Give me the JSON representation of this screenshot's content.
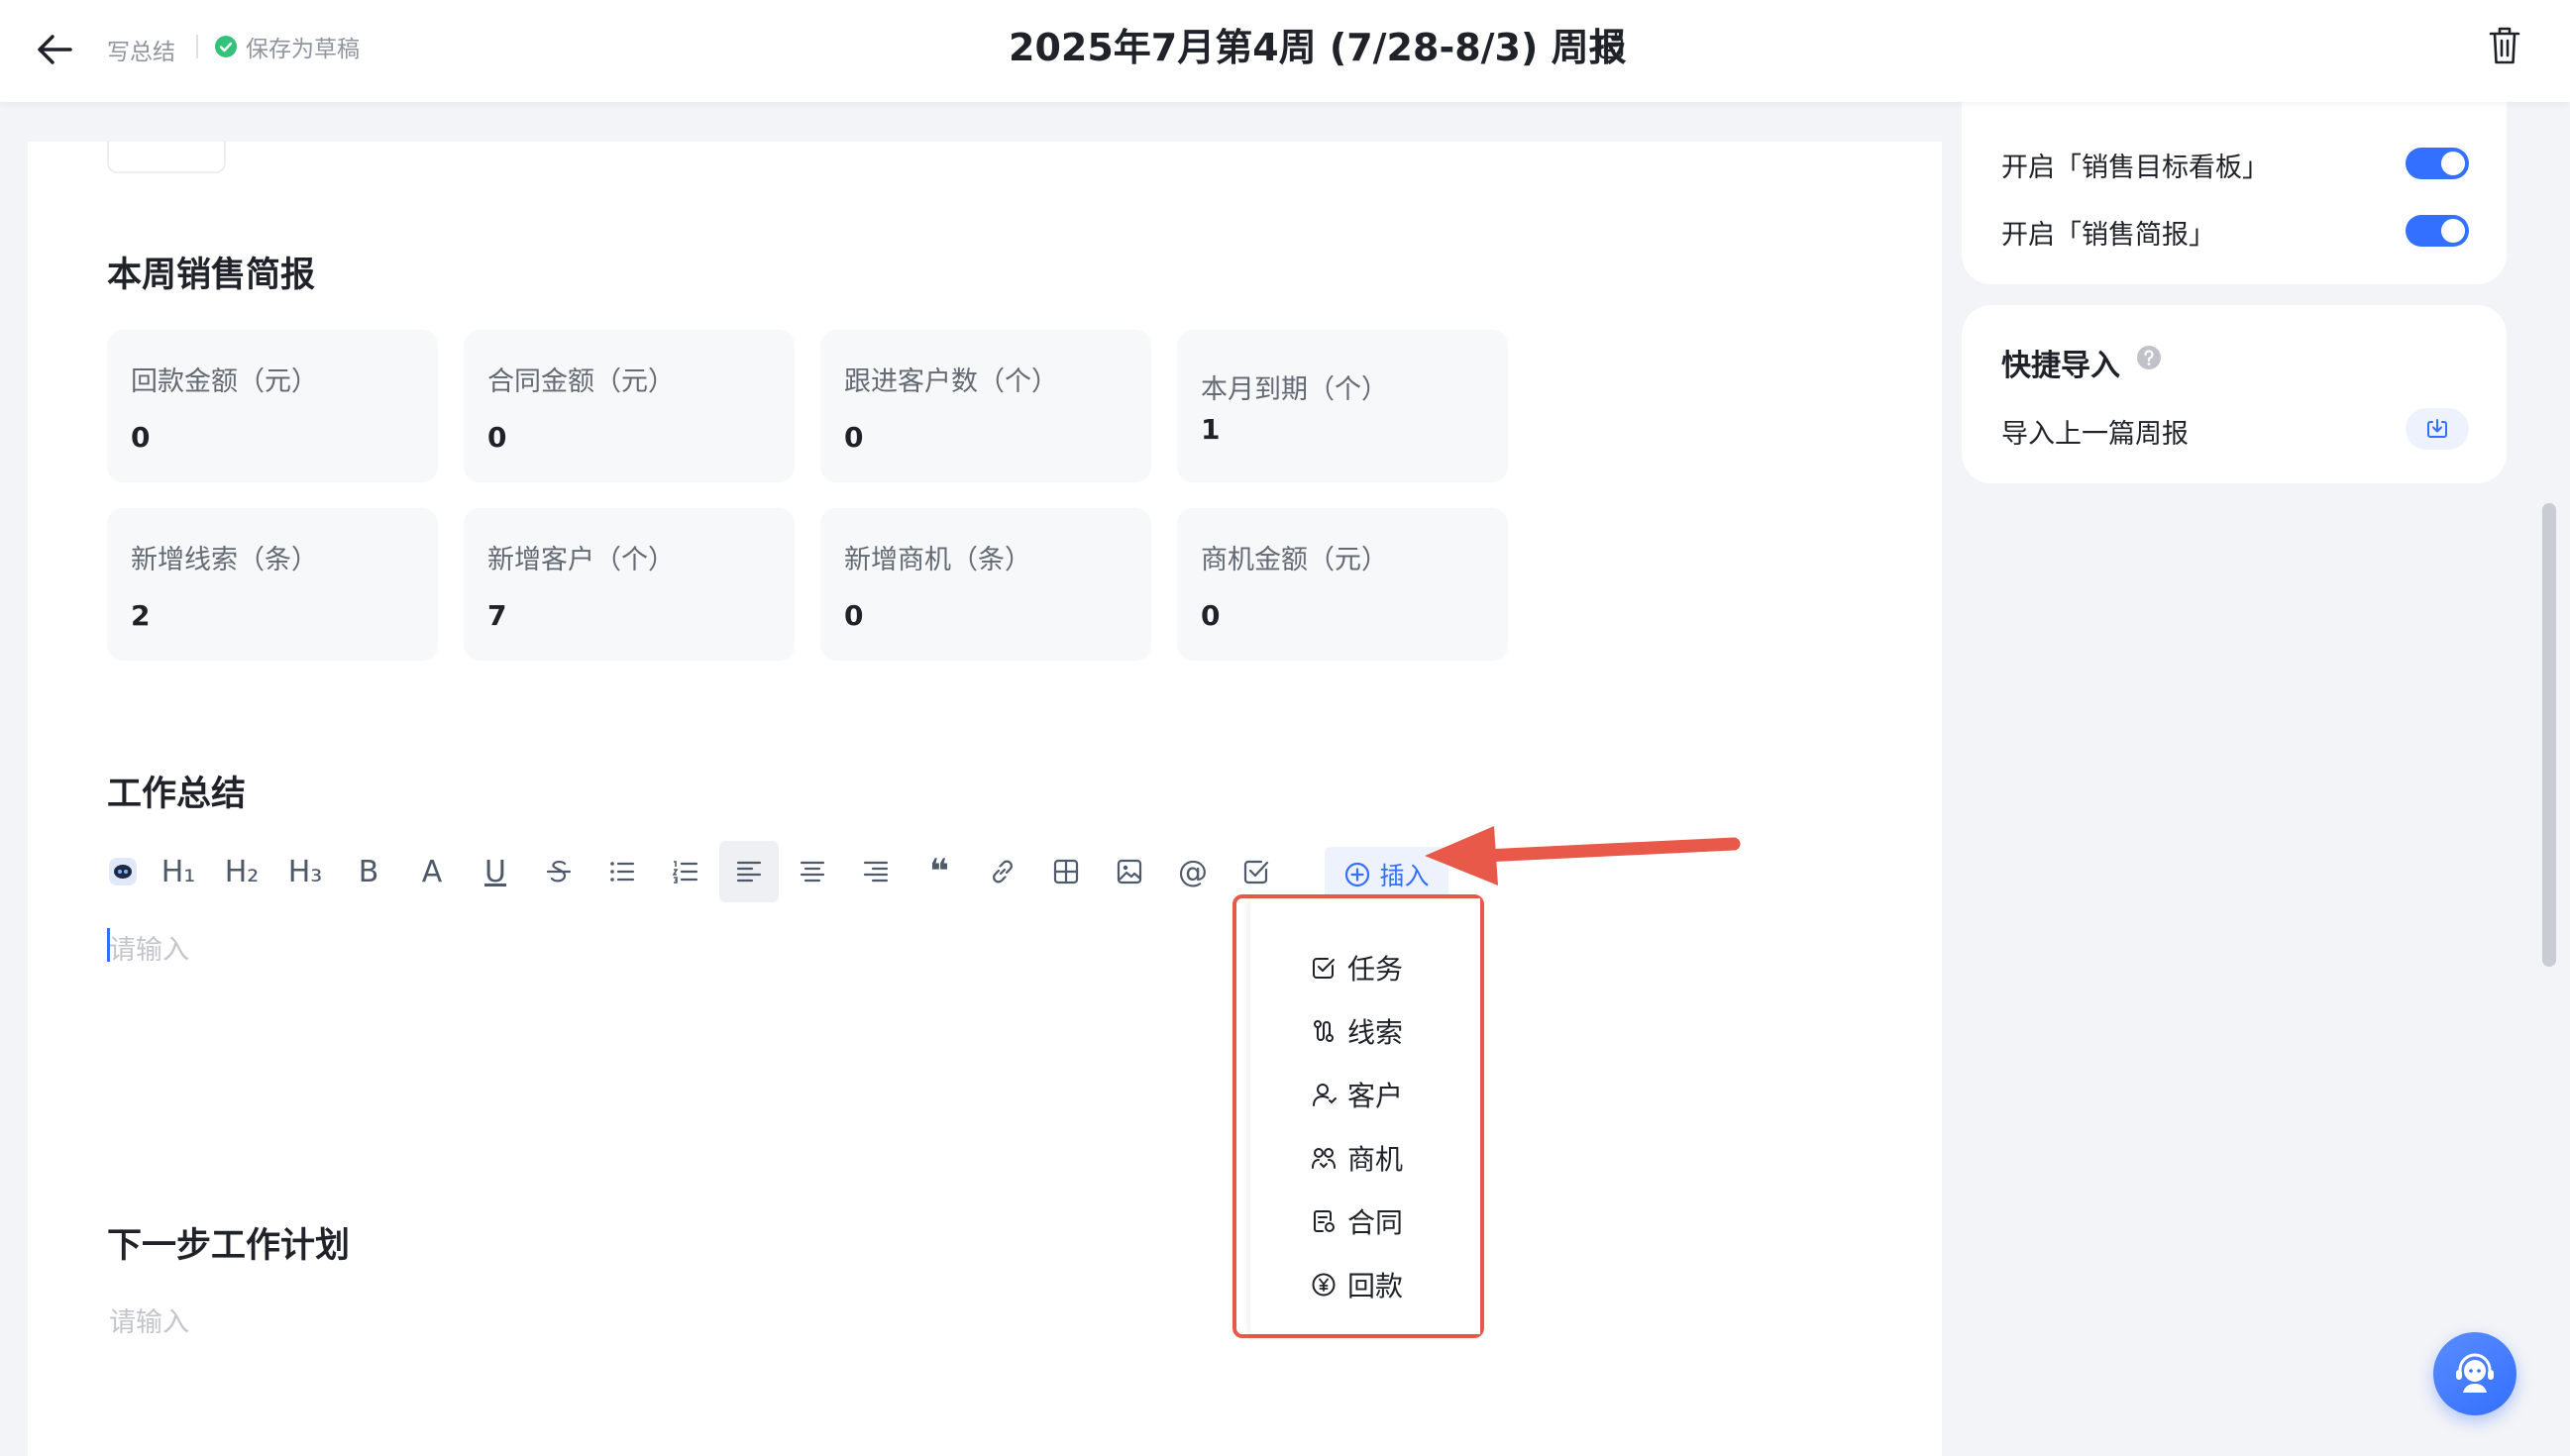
{
  "header": {
    "crumb": "写总结",
    "save_status": "保存为草稿",
    "title": "2025年7月第4周 (7/28-8/3) 周报"
  },
  "sales_brief": {
    "title": "本周销售简报",
    "stats": [
      {
        "label": "回款金额（元）",
        "value": "0"
      },
      {
        "label": "合同金额（元）",
        "value": "0"
      },
      {
        "label": "跟进客户数（个）",
        "value": "0"
      },
      {
        "label": "本月到期（个）",
        "value": "1"
      },
      {
        "label": "新增线索（条）",
        "value": "2"
      },
      {
        "label": "新增客户（个）",
        "value": "7"
      },
      {
        "label": "新增商机（条）",
        "value": "0"
      },
      {
        "label": "商机金额（元）",
        "value": "0"
      }
    ]
  },
  "work_summary": {
    "title": "工作总结",
    "placeholder": "请输入"
  },
  "toolbar": {
    "h1": "H₁",
    "h2": "H₂",
    "h3": "H₃",
    "bold": "B",
    "font_color": "A",
    "underline": "U",
    "quote": "❝",
    "mention": "@",
    "insert_label": "插入"
  },
  "insert_menu": {
    "items": [
      "任务",
      "线索",
      "客户",
      "商机",
      "合同",
      "回款"
    ]
  },
  "next_plan": {
    "title": "下一步工作计划",
    "placeholder": "请输入"
  },
  "sidebar": {
    "toggles": [
      {
        "label": "开启「销售目标看板」",
        "on": true
      },
      {
        "label": "开启「销售简报」",
        "on": true
      }
    ],
    "quick_import": {
      "title": "快捷导入",
      "item_label": "导入上一篇周报"
    }
  },
  "colors": {
    "accent": "#3370ff",
    "annotation": "#e8594a",
    "success": "#34c27a"
  }
}
